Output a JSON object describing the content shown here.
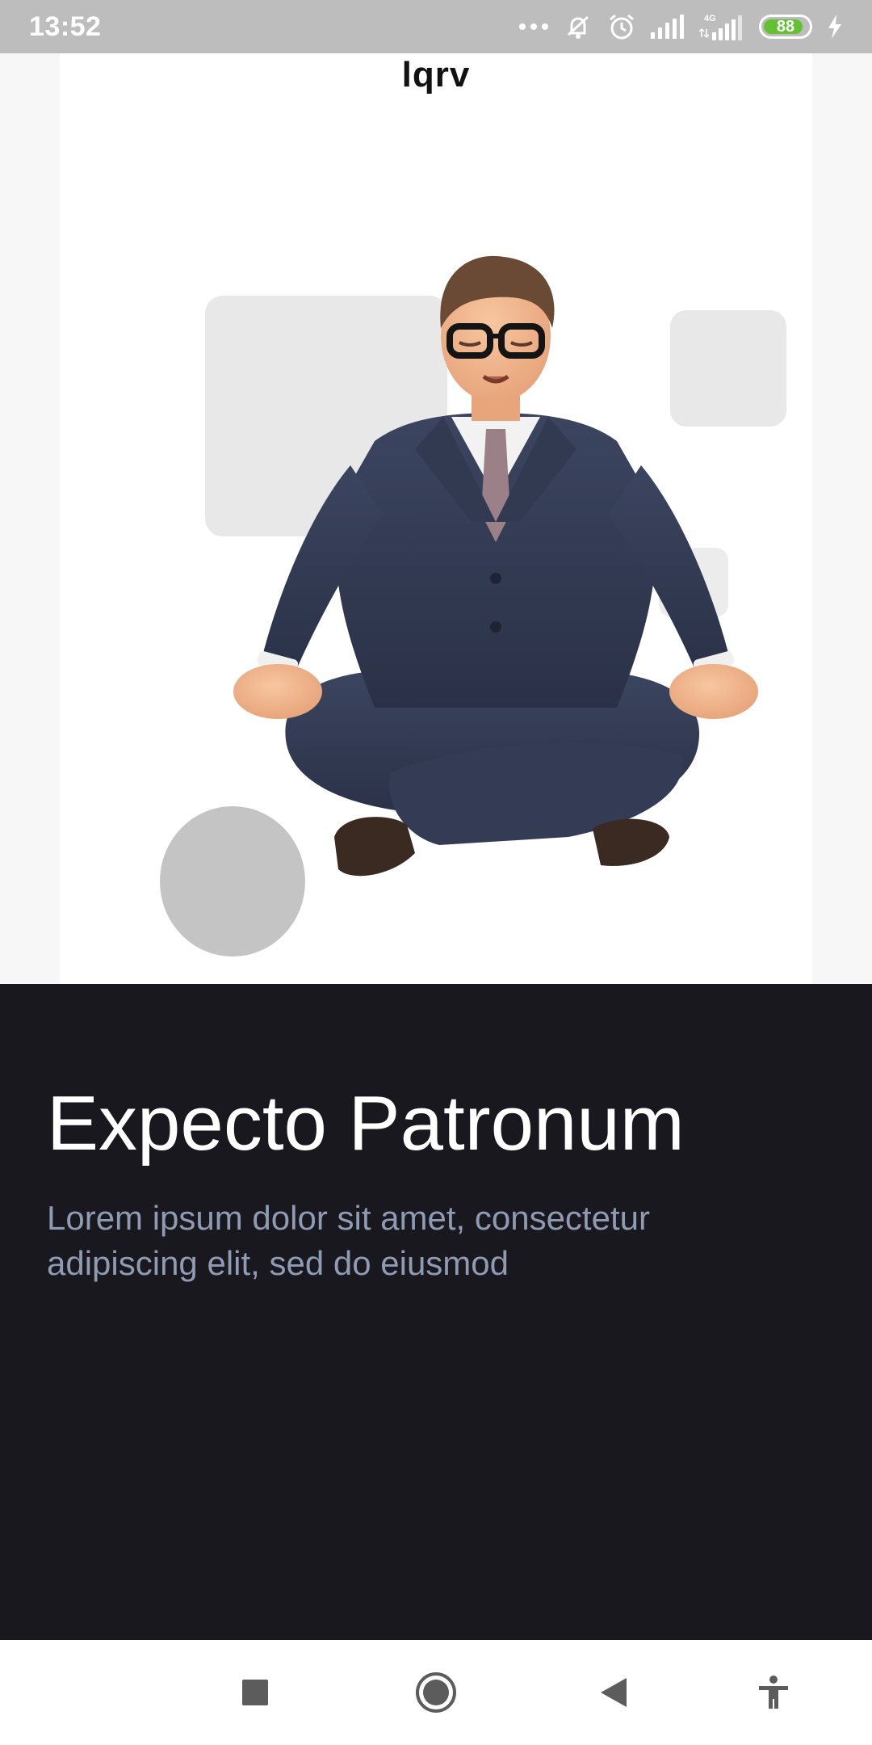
{
  "status_bar": {
    "time": "13:52",
    "network": "4G",
    "battery_level": "88",
    "icons": [
      "more-dots-icon",
      "mute-icon",
      "alarm-icon",
      "signal-icon",
      "signal-4g-icon",
      "battery-icon",
      "charging-icon"
    ]
  },
  "hero": {
    "brand_name": "lqrv",
    "illustration": "meditating-businessman"
  },
  "content": {
    "title": "Expecto Patronum",
    "description": "Lorem ipsum dolor sit amet, consectetur adipiscing elit, sed do eiusmod"
  },
  "nav_bar": {
    "buttons": [
      "recents-square-icon",
      "home-circle-icon",
      "back-triangle-icon",
      "accessibility-icon"
    ]
  },
  "colors": {
    "content_background": "#18181e",
    "title": "#ffffff",
    "description": "#8f9bb3",
    "battery_fill": "#63c132",
    "status_bar": "#bdbdbd"
  }
}
